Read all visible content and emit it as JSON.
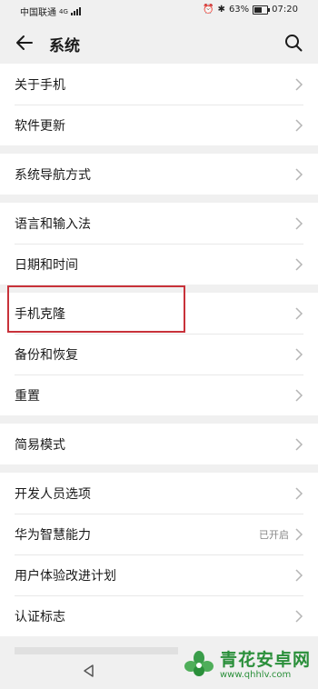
{
  "status_bar": {
    "carrier": "中国联通",
    "network": "4G",
    "battery": "63%",
    "battery_level": 0.63,
    "time": "07:20"
  },
  "header": {
    "title": "系统"
  },
  "groups": [
    {
      "items": [
        {
          "label": "关于手机"
        },
        {
          "label": "软件更新"
        }
      ]
    },
    {
      "items": [
        {
          "label": "系统导航方式"
        }
      ]
    },
    {
      "items": [
        {
          "label": "语言和输入法"
        },
        {
          "label": "日期和时间"
        }
      ]
    },
    {
      "items": [
        {
          "label": "手机克隆",
          "highlighted": true
        },
        {
          "label": "备份和恢复"
        },
        {
          "label": "重置"
        }
      ]
    },
    {
      "items": [
        {
          "label": "简易模式"
        }
      ]
    },
    {
      "items": [
        {
          "label": "开发人员选项"
        },
        {
          "label": "华为智慧能力",
          "value": "已开启"
        },
        {
          "label": "用户体验改进计划"
        },
        {
          "label": "认证标志"
        }
      ]
    }
  ],
  "watermark": {
    "title": "青花安卓网",
    "url": "www.qhhlv.com"
  },
  "colors": {
    "highlight_border": "#c8323a",
    "watermark": "#2a8f3a"
  }
}
